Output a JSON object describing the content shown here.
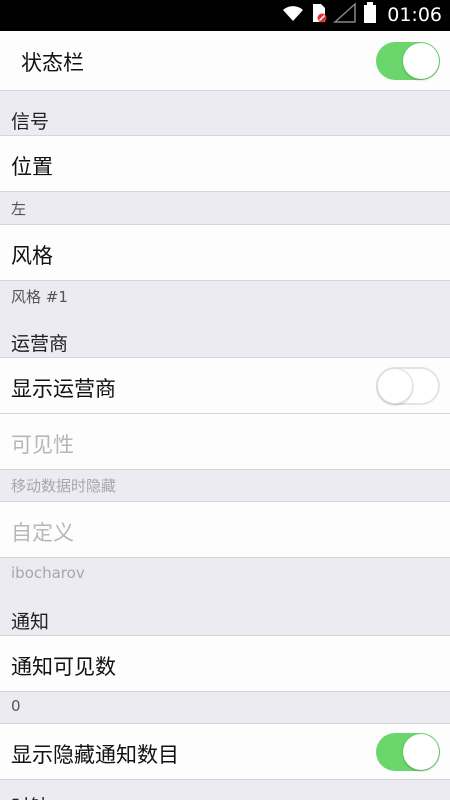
{
  "status_bar": {
    "time": "01:06",
    "icons": [
      "wifi-icon",
      "sim-icon",
      "signal-icon",
      "battery-icon"
    ]
  },
  "header_row": {
    "label": "状态栏",
    "toggle_on": true
  },
  "sections": {
    "signal": "信号",
    "carrier": "运营商",
    "notification": "通知",
    "clock": "时钟"
  },
  "rows": {
    "position": {
      "label": "位置",
      "value": "左"
    },
    "style": {
      "label": "风格",
      "value": "风格 #1"
    },
    "show_carrier": {
      "label": "显示运营商",
      "toggle_on": false
    },
    "visibility": {
      "label": "可见性",
      "value": "移动数据时隐藏"
    },
    "custom": {
      "label": "自定义",
      "value": "ibocharov"
    },
    "notif_visible_count": {
      "label": "通知可见数",
      "value": "0"
    },
    "show_hidden_count": {
      "label": "显示隐藏通知数目",
      "toggle_on": true
    }
  },
  "colors": {
    "toggle_on": "#6bd66b",
    "background": "#ebebf1",
    "row_bg": "#fdfdfd",
    "disabled_text": "#b7b7bb"
  }
}
